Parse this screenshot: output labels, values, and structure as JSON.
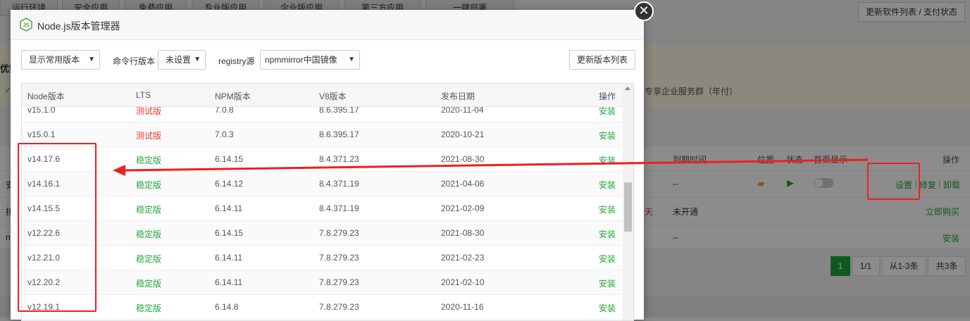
{
  "background": {
    "tabs": [
      "运行环境",
      "安全应用",
      "免费应用",
      "专业版应用",
      "企业版应用",
      "第三方应用",
      "一键部署"
    ],
    "update_button": "更新软件列表 / 支付状态",
    "banner_left": "优势",
    "banner_text": "专享企业服务群（年付）",
    "table_headers": {
      "expire": "到期时间",
      "location": "位置",
      "status": "状态",
      "homepage": "首页显示",
      "action": "操作"
    },
    "rows": [
      {
        "expire": "--",
        "actions": {
          "settings": "设置",
          "repair": "修复",
          "uninstall": "卸载"
        },
        "left": "安"
      },
      {
        "days": "天",
        "expire": "未开通",
        "action": "立即购买",
        "left": "拼"
      },
      {
        "expire": "--",
        "action": "安装",
        "left": "n"
      }
    ],
    "pager": {
      "current": "1",
      "pages": "1/1",
      "range": "从1-3条",
      "total": "共3条"
    }
  },
  "modal": {
    "title": "Node.js版本管理器",
    "filter_select": "显示常用版本",
    "cli_label": "命令行版本",
    "cli_select": "未设置",
    "registry_label": "registry源",
    "registry_select": "npmmirror中国镜像",
    "refresh_button": "更新版本列表",
    "columns": {
      "node": "Node版本",
      "lts": "LTS",
      "npm": "NPM版本",
      "v8": "V8版本",
      "date": "发布日期",
      "action": "操作"
    },
    "rows": [
      {
        "node": "v15.1.0",
        "lts": "测试版",
        "lts_type": "beta",
        "npm": "7.0.8",
        "v8": "8.6.395.17",
        "date": "2020-11-04",
        "action": "安装"
      },
      {
        "node": "v15.0.1",
        "lts": "测试版",
        "lts_type": "beta",
        "npm": "7.0.3",
        "v8": "8.6.395.17",
        "date": "2020-10-21",
        "action": "安装"
      },
      {
        "node": "v14.17.6",
        "lts": "稳定版",
        "lts_type": "stable",
        "npm": "6.14.15",
        "v8": "8.4.371.23",
        "date": "2021-08-30",
        "action": "安装"
      },
      {
        "node": "v14.16.1",
        "lts": "稳定版",
        "lts_type": "stable",
        "npm": "6.14.12",
        "v8": "8.4.371.19",
        "date": "2021-04-06",
        "action": "安装"
      },
      {
        "node": "v14.15.5",
        "lts": "稳定版",
        "lts_type": "stable",
        "npm": "6.14.11",
        "v8": "8.4.371.19",
        "date": "2021-02-09",
        "action": "安装"
      },
      {
        "node": "v12.22.6",
        "lts": "稳定版",
        "lts_type": "stable",
        "npm": "6.14.15",
        "v8": "7.8.279.23",
        "date": "2021-08-30",
        "action": "安装"
      },
      {
        "node": "v12.21.0",
        "lts": "稳定版",
        "lts_type": "stable",
        "npm": "6.14.11",
        "v8": "7.8.279.23",
        "date": "2021-02-23",
        "action": "安装"
      },
      {
        "node": "v12.20.2",
        "lts": "稳定版",
        "lts_type": "stable",
        "npm": "6.14.11",
        "v8": "7.8.279.23",
        "date": "2021-02-10",
        "action": "安装"
      },
      {
        "node": "v12.19.1",
        "lts": "稳定版",
        "lts_type": "stable",
        "npm": "6.14.8",
        "v8": "7.8.279.23",
        "date": "2020-11-16",
        "action": "安装"
      }
    ]
  },
  "colors": {
    "accent_green": "#20a53a",
    "beta_red": "#e53935",
    "annotation_red": "#f01e1e"
  }
}
